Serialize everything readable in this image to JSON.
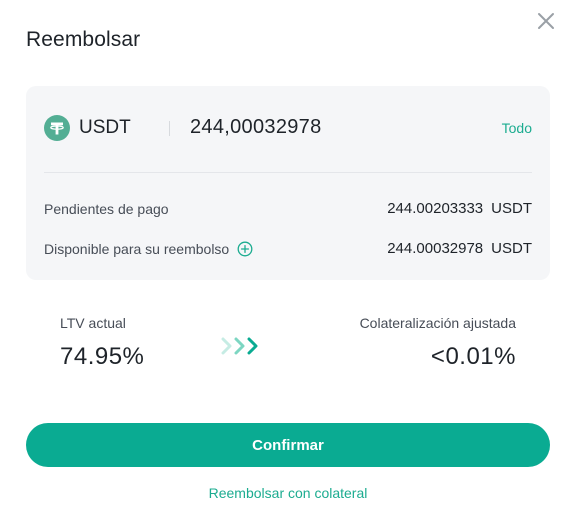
{
  "dialog": {
    "title": "Reembolsar",
    "close_icon": "close-icon"
  },
  "repay_card": {
    "token": {
      "symbol": "USDT",
      "icon": "tether-icon",
      "icon_color": "#53ae94"
    },
    "amount_value": "244,00032978",
    "max_label": "Todo",
    "pending": {
      "label": "Pendientes de pago",
      "value": "244.00203333",
      "unit": "USDT"
    },
    "available": {
      "label": "Disponible para su reembolso",
      "info_icon": "plus-circle-icon",
      "value": "244.00032978",
      "unit": "USDT"
    }
  },
  "ltv": {
    "current_label": "LTV actual",
    "current_value": "74.95%",
    "arrow_icon": "triple-chevron-right-icon",
    "adjusted_label": "Colateralización ajustada",
    "adjusted_value": "<0.01%"
  },
  "actions": {
    "confirm_label": "Confirmar",
    "collateral_link_label": "Reembolsar con colateral"
  },
  "colors": {
    "accent": "#0aab92",
    "link": "#1cac90",
    "card_bg": "#f5f6f8",
    "text_primary": "#1e2329",
    "text_secondary": "#474d57"
  }
}
